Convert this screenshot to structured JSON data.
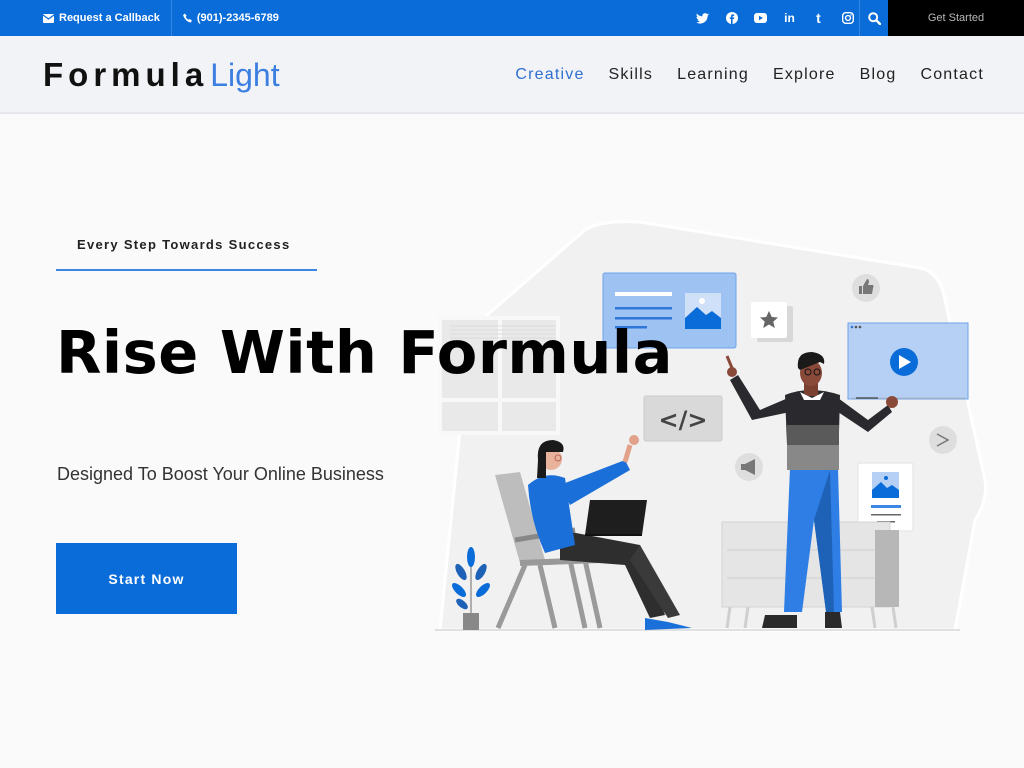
{
  "topbar": {
    "callback_label": "Request a Callback",
    "phone": "(901)-2345-6789",
    "social_icons": [
      "twitter-icon",
      "facebook-icon",
      "youtube-icon",
      "linkedin-icon",
      "tumblr-icon",
      "instagram-icon"
    ],
    "social_glyphs": [
      "𝕥",
      "f",
      "▶",
      "in",
      "t",
      "◎"
    ],
    "search_icon": "search-icon",
    "cta_label": "Get Started"
  },
  "header": {
    "logo_main": "Formula",
    "logo_accent": "Light",
    "nav": [
      {
        "label": "Creative",
        "active": true
      },
      {
        "label": "Skills",
        "active": false
      },
      {
        "label": "Learning",
        "active": false
      },
      {
        "label": "Explore",
        "active": false
      },
      {
        "label": "Blog",
        "active": false
      },
      {
        "label": "Contact",
        "active": false
      }
    ]
  },
  "hero": {
    "eyebrow": "Every Step Towards Success",
    "title": "Rise With Formula",
    "subtitle": "Designed To Boost Your Online Business",
    "cta_label": "Start Now",
    "code_badge": "</>"
  },
  "colors": {
    "brand_blue": "#0a6cd8",
    "accent_blue": "#3d7fe0",
    "topbar_cta_bg": "#000000",
    "page_bg": "#fafafa",
    "nav_bg": "#f2f3f7"
  }
}
